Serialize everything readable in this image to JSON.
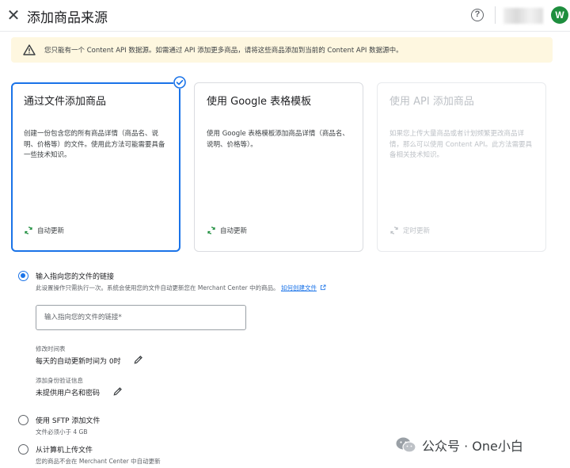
{
  "header": {
    "close_icon": "close-icon",
    "title": "添加商品来源",
    "help_icon": "help-icon",
    "help_glyph": "?",
    "avatar_letter": "W"
  },
  "banner": {
    "icon": "warning-icon",
    "text": "您只能有一个 Content API 数据源。如需通过 API 添加更多商品，请将这些商品添加到当前的 Content API 数据源中。"
  },
  "cards": [
    {
      "title": "通过文件添加商品",
      "description": "创建一份包含您的所有商品详情（商品名、说明、价格等）的文件。使用此方法可能需要具备一些技术知识。",
      "footer": "自动更新",
      "state": "selected"
    },
    {
      "title": "使用 Google 表格模板",
      "description": "使用 Google 表格模板添加商品详情（商品名、说明、价格等）。",
      "footer": "自动更新",
      "state": "normal"
    },
    {
      "title": "使用 API 添加商品",
      "description": "如果您上传大量商品或者计划频繁更改商品详情，那么可以使用 Content API。此方法需要具备相关技术知识。",
      "footer": "定时更新",
      "state": "disabled"
    }
  ],
  "options": {
    "link_option": {
      "label": "输入指向您的文件的链接",
      "sub_text": "此设置操作只需执行一次。系统会使用您的文件自动更新您在 Merchant Center 中的商品。",
      "sub_link": "如何创建文件",
      "selected": true,
      "input_placeholder": "输入指向您的文件的链接*",
      "schedule_caption": "修改时间表",
      "schedule_value": "每天的自动更新时间为 0时",
      "auth_caption": "添加身份验证信息",
      "auth_value": "未提供用户名和密码"
    },
    "sftp_option": {
      "label": "使用 SFTP 添加文件",
      "sub_text": "文件必须小于 4 GB",
      "selected": false
    },
    "upload_option": {
      "label": "从计算机上传文件",
      "sub_text": "您的商品不会在 Merchant Center 中自动更新",
      "selected": false
    }
  },
  "watermark": {
    "icon": "wechat-icon",
    "text": "公众号 · One小白"
  },
  "colors": {
    "accent": "#1a73e8",
    "banner_bg": "#fef7e0",
    "warning": "#e37400",
    "avatar_bg": "#1e8e3e",
    "sync_icon": "#1e8e3e"
  }
}
